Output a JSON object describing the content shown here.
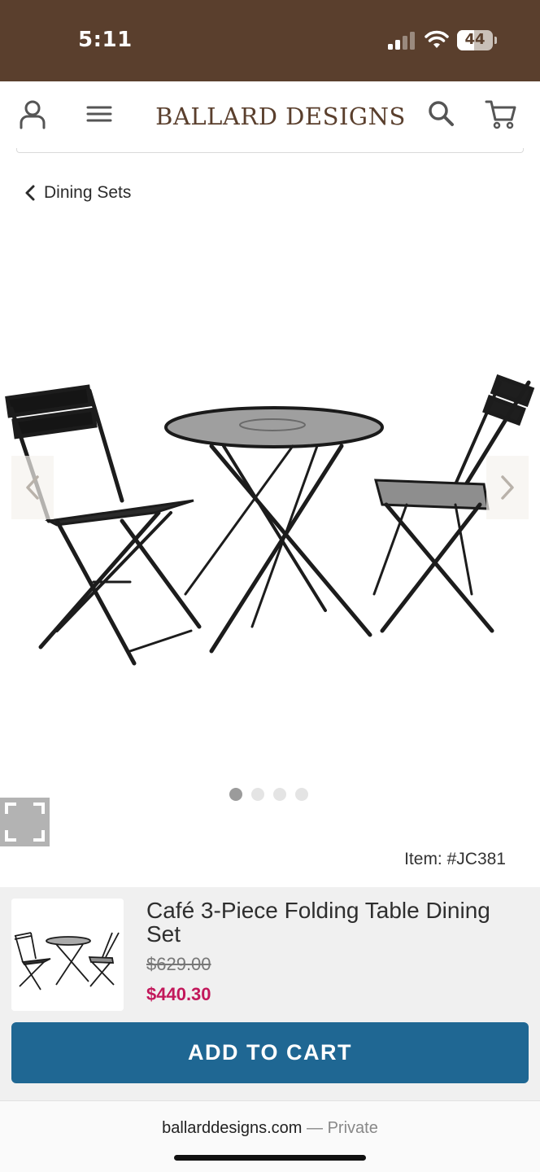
{
  "status_bar": {
    "time": "5:11",
    "battery": "44"
  },
  "header": {
    "logo": "BALLARD DESIGNS"
  },
  "breadcrumb": {
    "label": "Dining Sets"
  },
  "gallery": {
    "slides": 4,
    "active_slide": 1
  },
  "product": {
    "item_number": "Item: #JC381",
    "title": "Café 3-Piece Folding Table Dining Set",
    "price_original": "$629.00",
    "price_sale": "$440.30"
  },
  "actions": {
    "add_to_cart": "ADD TO CART"
  },
  "browser": {
    "domain": "ballarddesigns.com",
    "separator": "—",
    "mode": "Private"
  },
  "colors": {
    "brand_brown": "#5a3f2d",
    "cart_blue": "#1f6793",
    "sale_red": "#c2185b"
  }
}
